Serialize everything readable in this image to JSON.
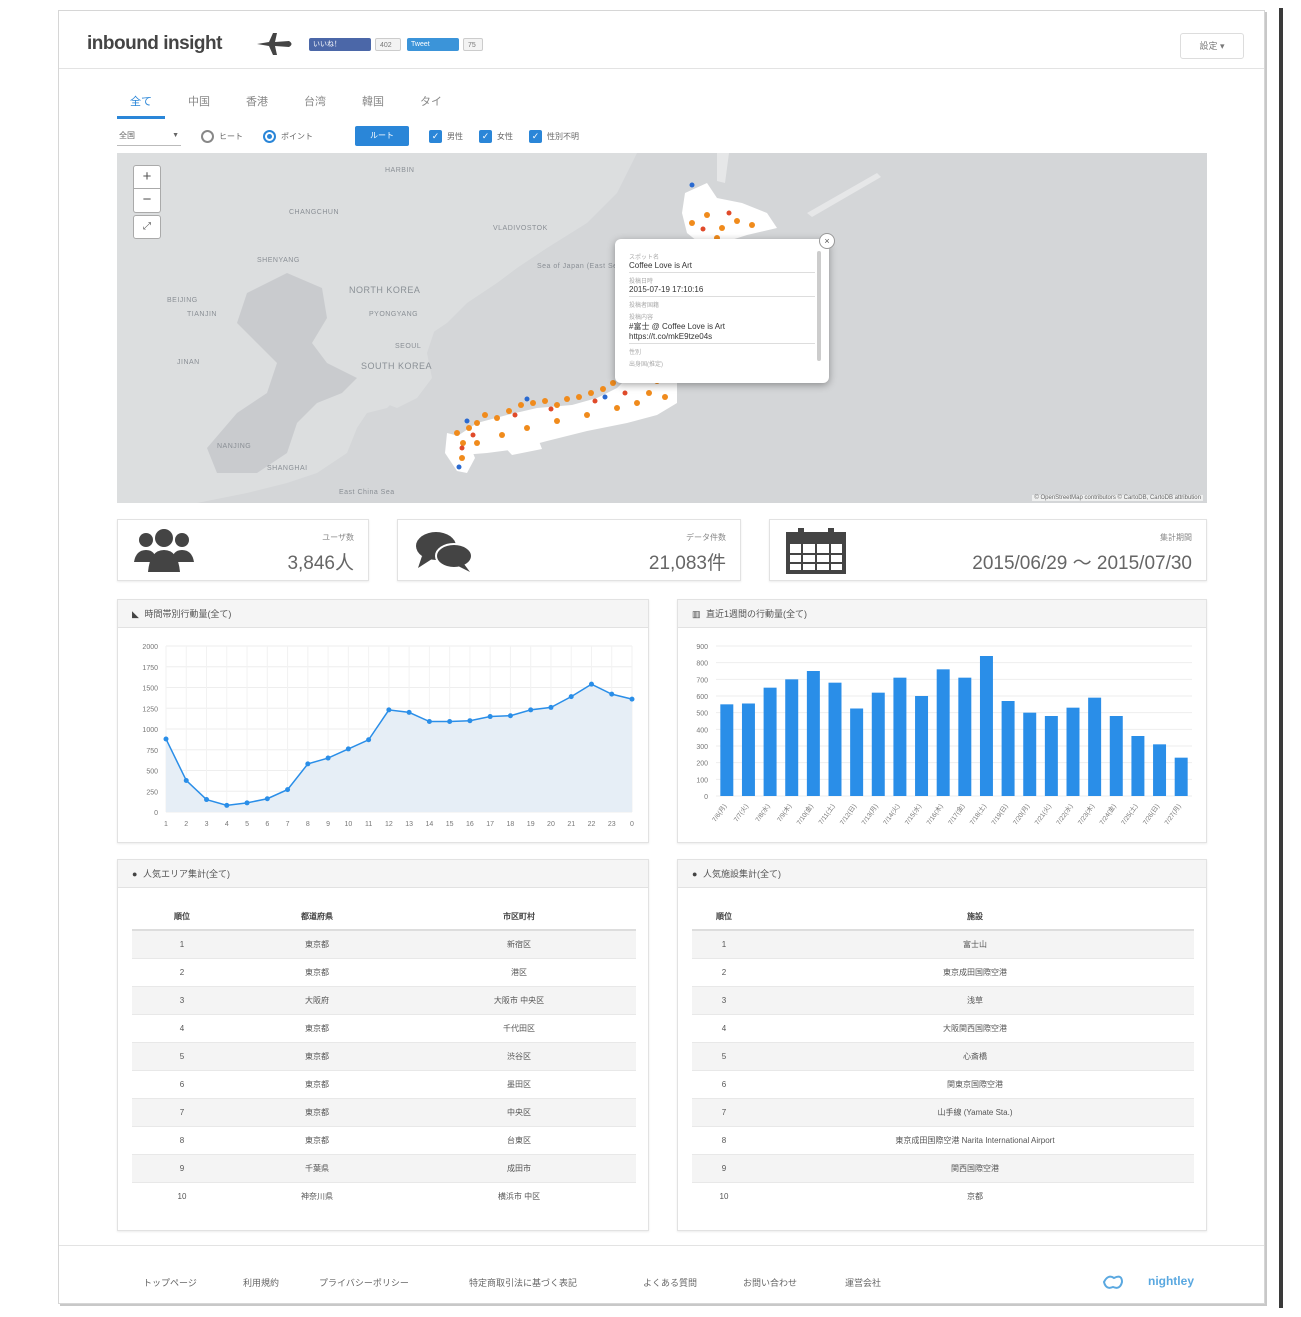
{
  "header": {
    "logo": "inbound insight",
    "like_label": "いいね！",
    "like_count": "402",
    "tweet_label": "Tweet",
    "tweet_count": "75",
    "settings_label": "設定 ▾"
  },
  "tabs": [
    "全て",
    "中国",
    "香港",
    "台湾",
    "韓国",
    "タイ"
  ],
  "filters": {
    "region": "全国",
    "radio_heat": "ヒート",
    "radio_point": "ポイント",
    "route_button": "ルート",
    "check_male": "男性",
    "check_female": "女性",
    "check_unknown": "性別不明"
  },
  "map": {
    "labels": {
      "harbin": "HARBIN",
      "changchun": "CHANGCHUN",
      "shenyang": "SHENYANG",
      "beijing": "BEIJING",
      "tianjin": "TIANJIN",
      "north_korea": "NORTH KOREA",
      "pyongyang": "PYONGYANG",
      "seoul": "SEOUL",
      "south_korea": "SOUTH KOREA",
      "vladivostok": "VLADIVOSTOK",
      "sea_of_japan": "Sea of Japan (East Sea)",
      "jinan": "JINAN",
      "nanjing": "NANJING",
      "shanghai": "SHANGHAI",
      "east_china_sea": "East China Sea"
    },
    "zoom_in": "+",
    "zoom_out": "−",
    "fullscreen": "⤢",
    "attribution": "© OpenStreetMap contributors © CartoDB, CartoDB attribution",
    "popup": {
      "close": "×",
      "cap1": "スポット名",
      "title": "Coffee Love is Art",
      "cap2": "投稿日時",
      "datetime": "2015-07-19 17:10:16",
      "cap3": "投稿者国籍",
      "cap4": "投稿内容",
      "body_line1": "#富士 @ Coffee Love is Art",
      "body_line2": "https://t.co/mkE9tze04s",
      "cap5": "性別",
      "cap6": "出身国(推定)"
    }
  },
  "stats": {
    "users_caption": "ユーザ数",
    "users_value": "3,846人",
    "data_caption": "データ件数",
    "data_value": "21,083件",
    "period_caption": "集計期間",
    "period_value": "2015/06/29 ～ 2015/07/30"
  },
  "panels": {
    "hourly_title": "時間帯別行動量(全て)",
    "daily_title": "直近1週間の行動量(全て)",
    "area_title": "人気エリア集計(全て)",
    "facility_title": "人気施設集計(全て)"
  },
  "chart_data": [
    {
      "type": "area",
      "title": "時間帯別行動量(全て)",
      "x": [
        "1",
        "2",
        "3",
        "4",
        "5",
        "6",
        "7",
        "8",
        "9",
        "10",
        "11",
        "12",
        "13",
        "14",
        "15",
        "16",
        "17",
        "18",
        "19",
        "20",
        "21",
        "22",
        "23",
        "0"
      ],
      "series": [
        {
          "values": [
            880,
            380,
            150,
            80,
            110,
            160,
            270,
            580,
            650,
            760,
            870,
            1230,
            1200,
            1090,
            1090,
            1100,
            1150,
            1160,
            1230,
            1260,
            1390,
            1540,
            1420,
            1360
          ]
        }
      ],
      "ylim": [
        0,
        2000
      ],
      "yticks": [
        "0",
        "250",
        "500",
        "750",
        "1000",
        "1250",
        "1500",
        "1750",
        "2000"
      ],
      "grid": true
    },
    {
      "type": "bar",
      "title": "直近1週間の行動量(全て)",
      "categories": [
        "7/6(月)",
        "7/7(火)",
        "7/8(水)",
        "7/9(木)",
        "7/10(金)",
        "7/11(土)",
        "7/12(日)",
        "7/13(月)",
        "7/14(火)",
        "7/15(水)",
        "7/16(木)",
        "7/17(金)",
        "7/18(土)",
        "7/19(日)",
        "7/20(月)",
        "7/21(火)",
        "7/22(水)",
        "7/23(木)",
        "7/24(金)",
        "7/25(土)",
        "7/26(日)",
        "7/27(月)"
      ],
      "series": [
        {
          "values": [
            550,
            555,
            650,
            700,
            750,
            680,
            525,
            620,
            710,
            600,
            760,
            710,
            840,
            570,
            500,
            480,
            530,
            590,
            480,
            360,
            310,
            230
          ]
        }
      ],
      "ylim": [
        0,
        900
      ],
      "yticks": [
        "0",
        "100",
        "200",
        "300",
        "400",
        "500",
        "600",
        "700",
        "800",
        "900"
      ],
      "color": "#2a8ee8",
      "grid": true
    }
  ],
  "area_table": {
    "headers": [
      "順位",
      "都道府県",
      "市区町村"
    ],
    "rows": [
      [
        "1",
        "東京都",
        "新宿区"
      ],
      [
        "2",
        "東京都",
        "港区"
      ],
      [
        "3",
        "大阪府",
        "大阪市 中央区"
      ],
      [
        "4",
        "東京都",
        "千代田区"
      ],
      [
        "5",
        "東京都",
        "渋谷区"
      ],
      [
        "6",
        "東京都",
        "墨田区"
      ],
      [
        "7",
        "東京都",
        "中央区"
      ],
      [
        "8",
        "東京都",
        "台東区"
      ],
      [
        "9",
        "千葉県",
        "成田市"
      ],
      [
        "10",
        "神奈川県",
        "横浜市 中区"
      ]
    ]
  },
  "facility_table": {
    "headers": [
      "順位",
      "施設"
    ],
    "rows": [
      [
        "1",
        "富士山"
      ],
      [
        "2",
        "東京成田国際空港"
      ],
      [
        "3",
        "浅草"
      ],
      [
        "4",
        "大阪関西国際空港"
      ],
      [
        "5",
        "心斎橋"
      ],
      [
        "6",
        "関東京国際空港"
      ],
      [
        "7",
        "山手線 (Yamate Sta.)"
      ],
      [
        "8",
        "東京成田国際空港 Narita International Airport"
      ],
      [
        "9",
        "関西国際空港"
      ],
      [
        "10",
        "京都"
      ]
    ]
  },
  "footer": {
    "links": [
      "トップページ",
      "利用規約",
      "プライバシーポリシー",
      "特定商取引法に基づく表記",
      "よくある質問",
      "お問い合わせ",
      "運営会社"
    ],
    "brand": "nightley"
  }
}
